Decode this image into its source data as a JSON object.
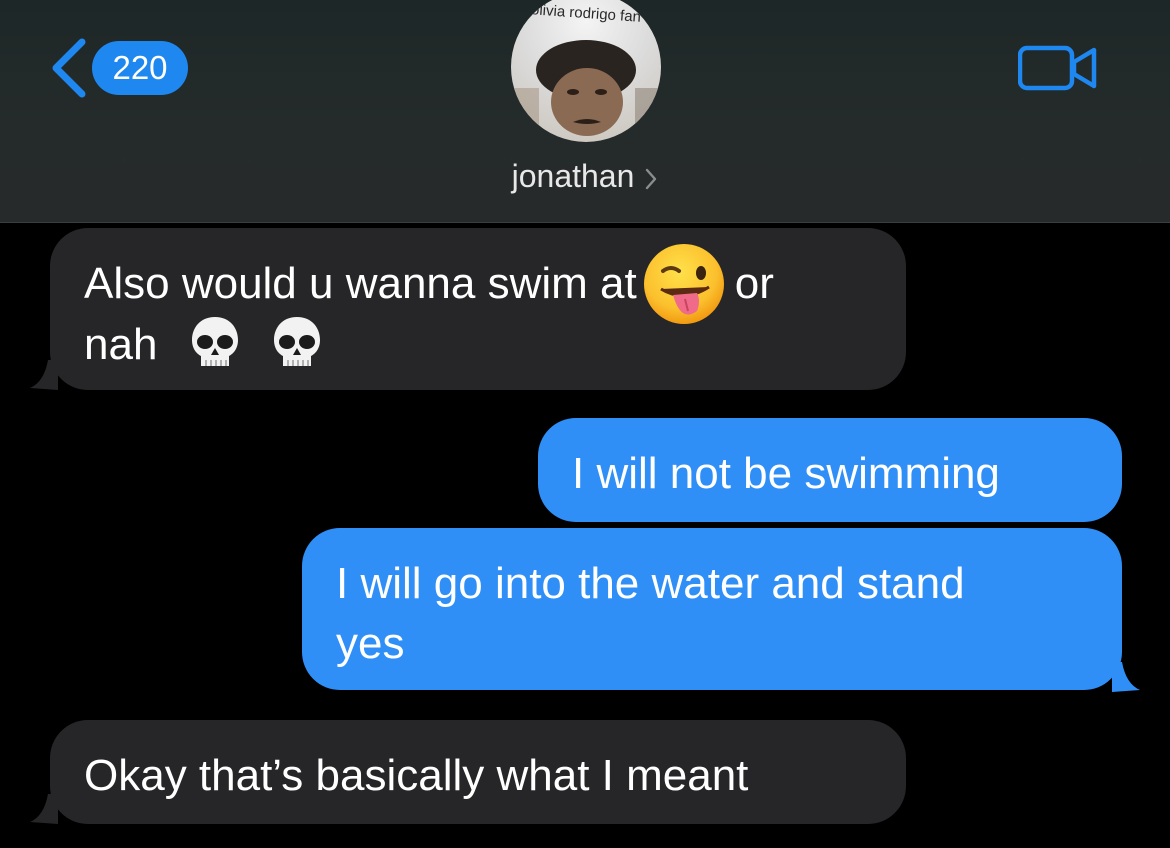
{
  "header": {
    "back_badge": "220",
    "avatar_caption": "olivia rodrigo fan",
    "contact_name": "jonathan",
    "video_icon": "video-camera-icon",
    "back_icon": "chevron-left-icon"
  },
  "messages": [
    {
      "direction": "incoming",
      "line1_a": "Also would u wanna swim at",
      "line1_emoji": "winking-face-with-tongue",
      "line1_b": "or",
      "line2": "nah",
      "line2_emojis": [
        "skull",
        "skull"
      ]
    },
    {
      "direction": "outgoing",
      "text": "I will not be swimming"
    },
    {
      "direction": "outgoing",
      "line1": "I will go into the water and stand",
      "line2": "yes"
    },
    {
      "direction": "incoming",
      "text": "Okay that’s basically what I meant"
    }
  ],
  "colors": {
    "accent": "#1e87f0",
    "outgoing_bubble": "#2f8ff7",
    "incoming_bubble": "#262628",
    "background": "#000000"
  }
}
